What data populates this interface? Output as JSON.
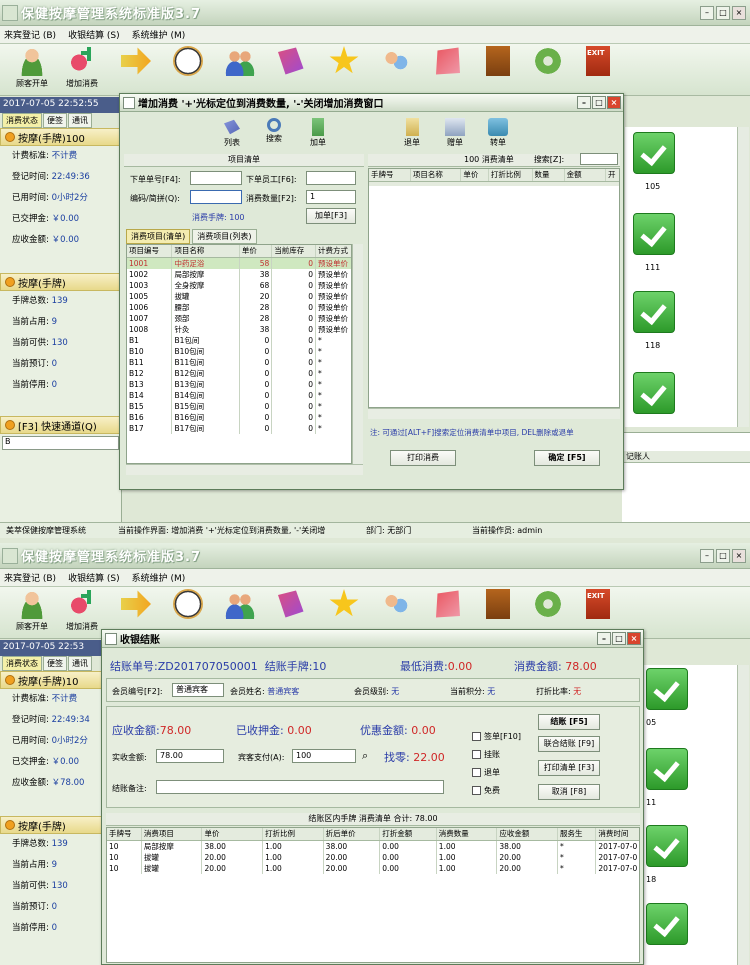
{
  "app": {
    "title": "保健按摩管理系统标准版3.7",
    "menu": [
      "来宾登记 (B)",
      "收银结算 (S)",
      "系统维护 (M)"
    ],
    "toolbar": [
      {
        "label": "顾客开单",
        "icon": "person-icon"
      },
      {
        "label": "增加消费",
        "icon": "add-consume-icon"
      },
      {
        "label": "",
        "icon": "arrow-icon"
      },
      {
        "label": "",
        "icon": "clock-icon"
      },
      {
        "label": "",
        "icon": "users-icon"
      },
      {
        "label": "",
        "icon": "book-icon"
      },
      {
        "label": "",
        "icon": "star-icon"
      },
      {
        "label": "",
        "icon": "faces-icon"
      },
      {
        "label": "",
        "icon": "calc-icon"
      },
      {
        "label": "",
        "icon": "door-icon"
      },
      {
        "label": "",
        "icon": "gear-icon"
      },
      {
        "label": "",
        "icon": "exit-icon"
      }
    ]
  },
  "left": {
    "datetime1": "2017-07-05 22:52:55",
    "datetime2": "2017-07-05 22:53",
    "tabs": [
      "消费状态",
      "便签",
      "通讯"
    ],
    "section1": "按摩(手牌)100",
    "section1b": "按摩(手牌)10",
    "fields1": [
      {
        "k": "计费标准:",
        "v": "不计费"
      },
      {
        "k": "登记时间:",
        "v": "22:49:36"
      },
      {
        "k": "已用时间:",
        "v": "0小时2分"
      },
      {
        "k": "已交押金:",
        "v": "￥0.00"
      },
      {
        "k": "应收金额:",
        "v": "￥0.00"
      }
    ],
    "fields1b": [
      {
        "k": "计费标准:",
        "v": "不计费"
      },
      {
        "k": "登记时间:",
        "v": "22:49:34"
      },
      {
        "k": "已用时间:",
        "v": "0小时2分"
      },
      {
        "k": "已交押金:",
        "v": "￥0.00"
      },
      {
        "k": "应收金额:",
        "v": "￥78.00"
      }
    ],
    "section2": "按摩(手牌)",
    "fields2": [
      {
        "k": "手牌总数:",
        "v": "139"
      },
      {
        "k": "当前占用:",
        "v": "9"
      },
      {
        "k": "当前可供:",
        "v": "130"
      },
      {
        "k": "当前预订:",
        "v": "0"
      },
      {
        "k": "当前停用:",
        "v": "0"
      }
    ],
    "quick": "[F3] 快速通道(Q)",
    "quick_value": "B"
  },
  "grid": {
    "numbers": [
      "105",
      "111",
      "118"
    ],
    "numbers2": [
      "05",
      "11",
      "18"
    ],
    "col_right": "记账人"
  },
  "status": {
    "app_name": "美萃保健按摩管理系统",
    "current": "当前操作界面: 增加消费 '+'光标定位到消费数量, '-'关闭增",
    "dept": "部门: 无部门",
    "operator": "当前操作员: admin"
  },
  "dlg1": {
    "title": "增加消费  '+'光标定位到消费数量, '-'关闭增加消费窗口",
    "tb_left": [
      "列表",
      "搜索",
      "加单"
    ],
    "tb_right": [
      "退单",
      "赠单",
      "转单"
    ],
    "left_head": "项目清单",
    "right_head": "100 消费清单",
    "search_label": "搜索[Z]:",
    "f_order": "下单单号[F4]:",
    "f_staff": "下单员工[F6]:",
    "f_code": "编码/简拼(Q):",
    "f_qty": "消费数量[F2]:",
    "qty_value": "1",
    "hand": "消费手牌: 100",
    "add_btn": "加单[F3]",
    "tabs": [
      "消费项目(清单)",
      "消费项目(列表)"
    ],
    "cols": [
      "项目编号",
      "项目名称",
      "单价",
      "当前库存",
      "计费方式"
    ],
    "rows": [
      [
        "1001",
        "中药足浴",
        "58",
        "0",
        "预设单价"
      ],
      [
        "1002",
        "局部按摩",
        "38",
        "0",
        "预设单价"
      ],
      [
        "1003",
        "全身按摩",
        "68",
        "0",
        "预设单价"
      ],
      [
        "1005",
        "拔罐",
        "20",
        "0",
        "预设单价"
      ],
      [
        "1006",
        "腰部",
        "28",
        "0",
        "预设单价"
      ],
      [
        "1007",
        "颈部",
        "28",
        "0",
        "预设单价"
      ],
      [
        "1008",
        "针灸",
        "38",
        "0",
        "预设单价"
      ],
      [
        "B1",
        "B1包间",
        "0",
        "0",
        "*"
      ],
      [
        "B10",
        "B10包间",
        "0",
        "0",
        "*"
      ],
      [
        "B11",
        "B11包间",
        "0",
        "0",
        "*"
      ],
      [
        "B12",
        "B12包间",
        "0",
        "0",
        "*"
      ],
      [
        "B13",
        "B13包间",
        "0",
        "0",
        "*"
      ],
      [
        "B14",
        "B14包间",
        "0",
        "0",
        "*"
      ],
      [
        "B15",
        "B15包间",
        "0",
        "0",
        "*"
      ],
      [
        "B16",
        "B16包间",
        "0",
        "0",
        "*"
      ],
      [
        "B17",
        "B17包间",
        "0",
        "0",
        "*"
      ]
    ],
    "right_cols": [
      "手牌号",
      "项目名称",
      "单价",
      "打折比例",
      "数量",
      "金额",
      "开"
    ],
    "note": "注: 可通过[ALT+F]搜索定位消费清单中项目, DEL删除或退单",
    "print_btn": "打印消费",
    "ok_btn": "确定 [F5]"
  },
  "dlg2": {
    "title": "收银结账",
    "order_no": "结账单号:ZD201707050001",
    "hand": "结账手牌:10",
    "min_label": "最低消费:",
    "min_value": "0.00",
    "amount_label": "消费金额:",
    "amount_value": "78.00",
    "member_no": "会员编号[F2]:",
    "member_no_value": "普通宾客",
    "member_name": "会员姓名:",
    "member_name_value": "普通宾客",
    "member_level": "会员级别:",
    "member_level_value": "无",
    "points": "当前积分:",
    "points_value": "无",
    "discount": "打折比率:",
    "discount_value": "无",
    "due_label": "应收金额:",
    "due_value": "78.00",
    "deposit_label": "已收押金:",
    "deposit_value": "0.00",
    "promo_label": "优惠金额:",
    "promo_value": "0.00",
    "paid_label": "实收金额:",
    "paid_value": "78.00",
    "guest_pay": "宾客支付(A):",
    "guest_pay_value": "100",
    "change_label": "找零:",
    "change_value": "22.00",
    "remark": "结账备注:",
    "checks": [
      "签单[F10]",
      "挂账",
      "退单",
      "免费"
    ],
    "buttons": [
      "结账 [F5]",
      "联合结账 [F9]",
      "打印清单 [F3]",
      "取消 [F8]"
    ],
    "list_head": "结账区内手牌  消费清单  合计: 78.00",
    "cols": [
      "手牌号",
      "消费项目",
      "单价",
      "打折比例",
      "折后单价",
      "打折金额",
      "消费数量",
      "应收金额",
      "服务生",
      "消费时间"
    ],
    "rows": [
      [
        "10",
        "局部按摩",
        "38.00",
        "1.00",
        "38.00",
        "0.00",
        "1.00",
        "38.00",
        "*",
        "2017-07-0"
      ],
      [
        "10",
        "拔罐",
        "20.00",
        "1.00",
        "20.00",
        "0.00",
        "1.00",
        "20.00",
        "*",
        "2017-07-0"
      ],
      [
        "10",
        "拔罐",
        "20.00",
        "1.00",
        "20.00",
        "0.00",
        "1.00",
        "20.00",
        "*",
        "2017-07-0"
      ]
    ]
  }
}
